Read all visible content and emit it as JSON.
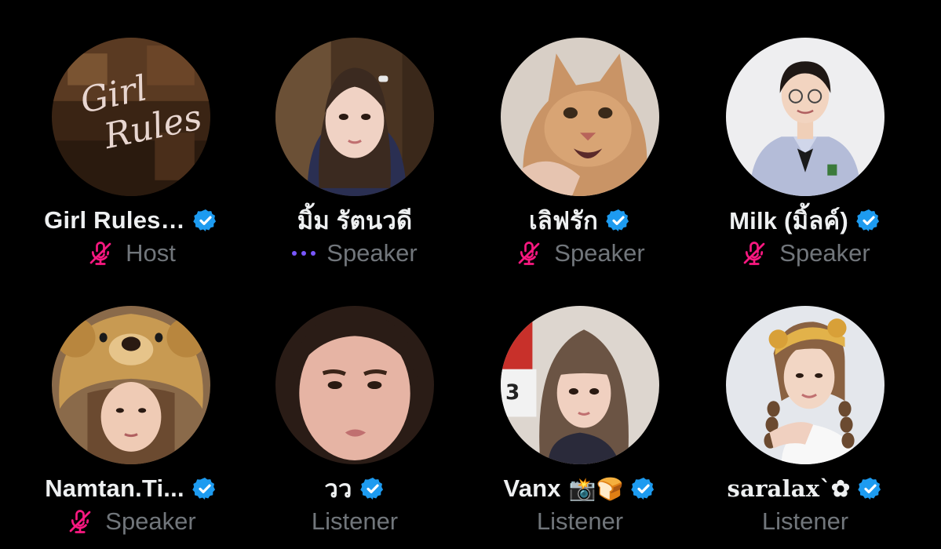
{
  "participants": [
    {
      "name": "Girl Rules…",
      "role": "Host",
      "verified": true,
      "status": "muted",
      "avatar_icon": "girl-rules-logo-avatar"
    },
    {
      "name": "มิ้ม รัตนวดี",
      "role": "Speaker",
      "verified": false,
      "status": "speaking",
      "avatar_icon": "woman-portrait-avatar"
    },
    {
      "name": "เลิฟรัก",
      "role": "Speaker",
      "verified": true,
      "status": "muted",
      "avatar_icon": "cat-avatar"
    },
    {
      "name": "Milk (มิ้ลค์)",
      "role": "Speaker",
      "verified": true,
      "status": "muted",
      "avatar_icon": "student-portrait-avatar"
    },
    {
      "name": "Namtan.Ti...",
      "role": "Speaker",
      "verified": true,
      "status": "muted",
      "avatar_icon": "bear-hat-portrait-avatar"
    },
    {
      "name": "วว",
      "role": "Listener",
      "verified": true,
      "status": "none",
      "avatar_icon": "closeup-portrait-avatar"
    },
    {
      "name": "Vanx",
      "name_emoji": "📸🍞",
      "role": "Listener",
      "verified": true,
      "status": "none",
      "avatar_icon": "bangs-portrait-avatar"
    },
    {
      "name": "saralax`✿",
      "role": "Listener",
      "verified": true,
      "status": "none",
      "avatar_icon": "braids-portrait-avatar"
    }
  ],
  "colors": {
    "background": "#000000",
    "verified_badge": "#1d9bf0",
    "muted_mic": "#f91880",
    "speaking_dots": "#7856ff",
    "role_text": "#71767b"
  }
}
